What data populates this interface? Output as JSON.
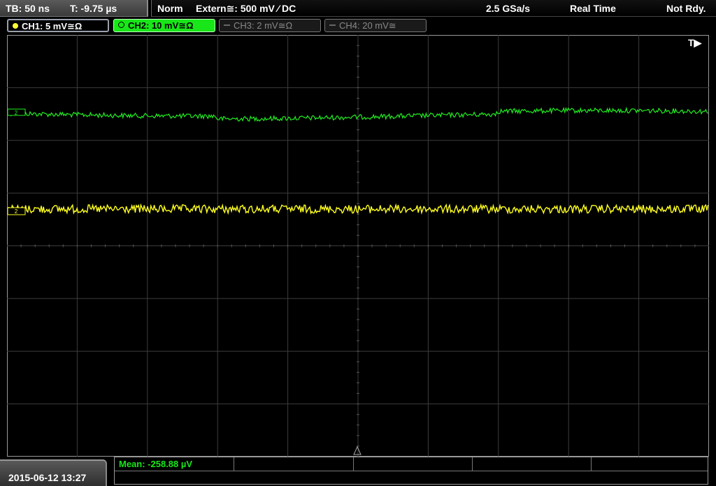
{
  "status_bar": {
    "timebase": "TB: 50 ns",
    "trigger_time": "T: -9.75 µs",
    "trigger_mode": "Norm",
    "trigger_source": "Extern≅: 500 mV ⁄ DC",
    "sample_rate": "2.5 GSa/s",
    "acquisition_mode": "Real Time",
    "trigger_status": "Not Rdy."
  },
  "channels": [
    {
      "label": "CH1: 5 mV≅Ω",
      "color": "#ffff33",
      "active": true
    },
    {
      "label": "CH2: 10 mV≅Ω",
      "color": "#19e619",
      "active": true,
      "selected": true
    },
    {
      "label": "CH3: 2 mV≅Ω",
      "color": "#888888",
      "active": false
    },
    {
      "label": "CH4: 20 mV≅",
      "color": "#888888",
      "active": false
    }
  ],
  "plot": {
    "trigger_marker": "T▶",
    "ch1_marker": "2",
    "ch2_marker": "2"
  },
  "datetime": "2015-06-12 13:27",
  "measurement": {
    "mean": "Mean: -258.88 µV"
  }
}
